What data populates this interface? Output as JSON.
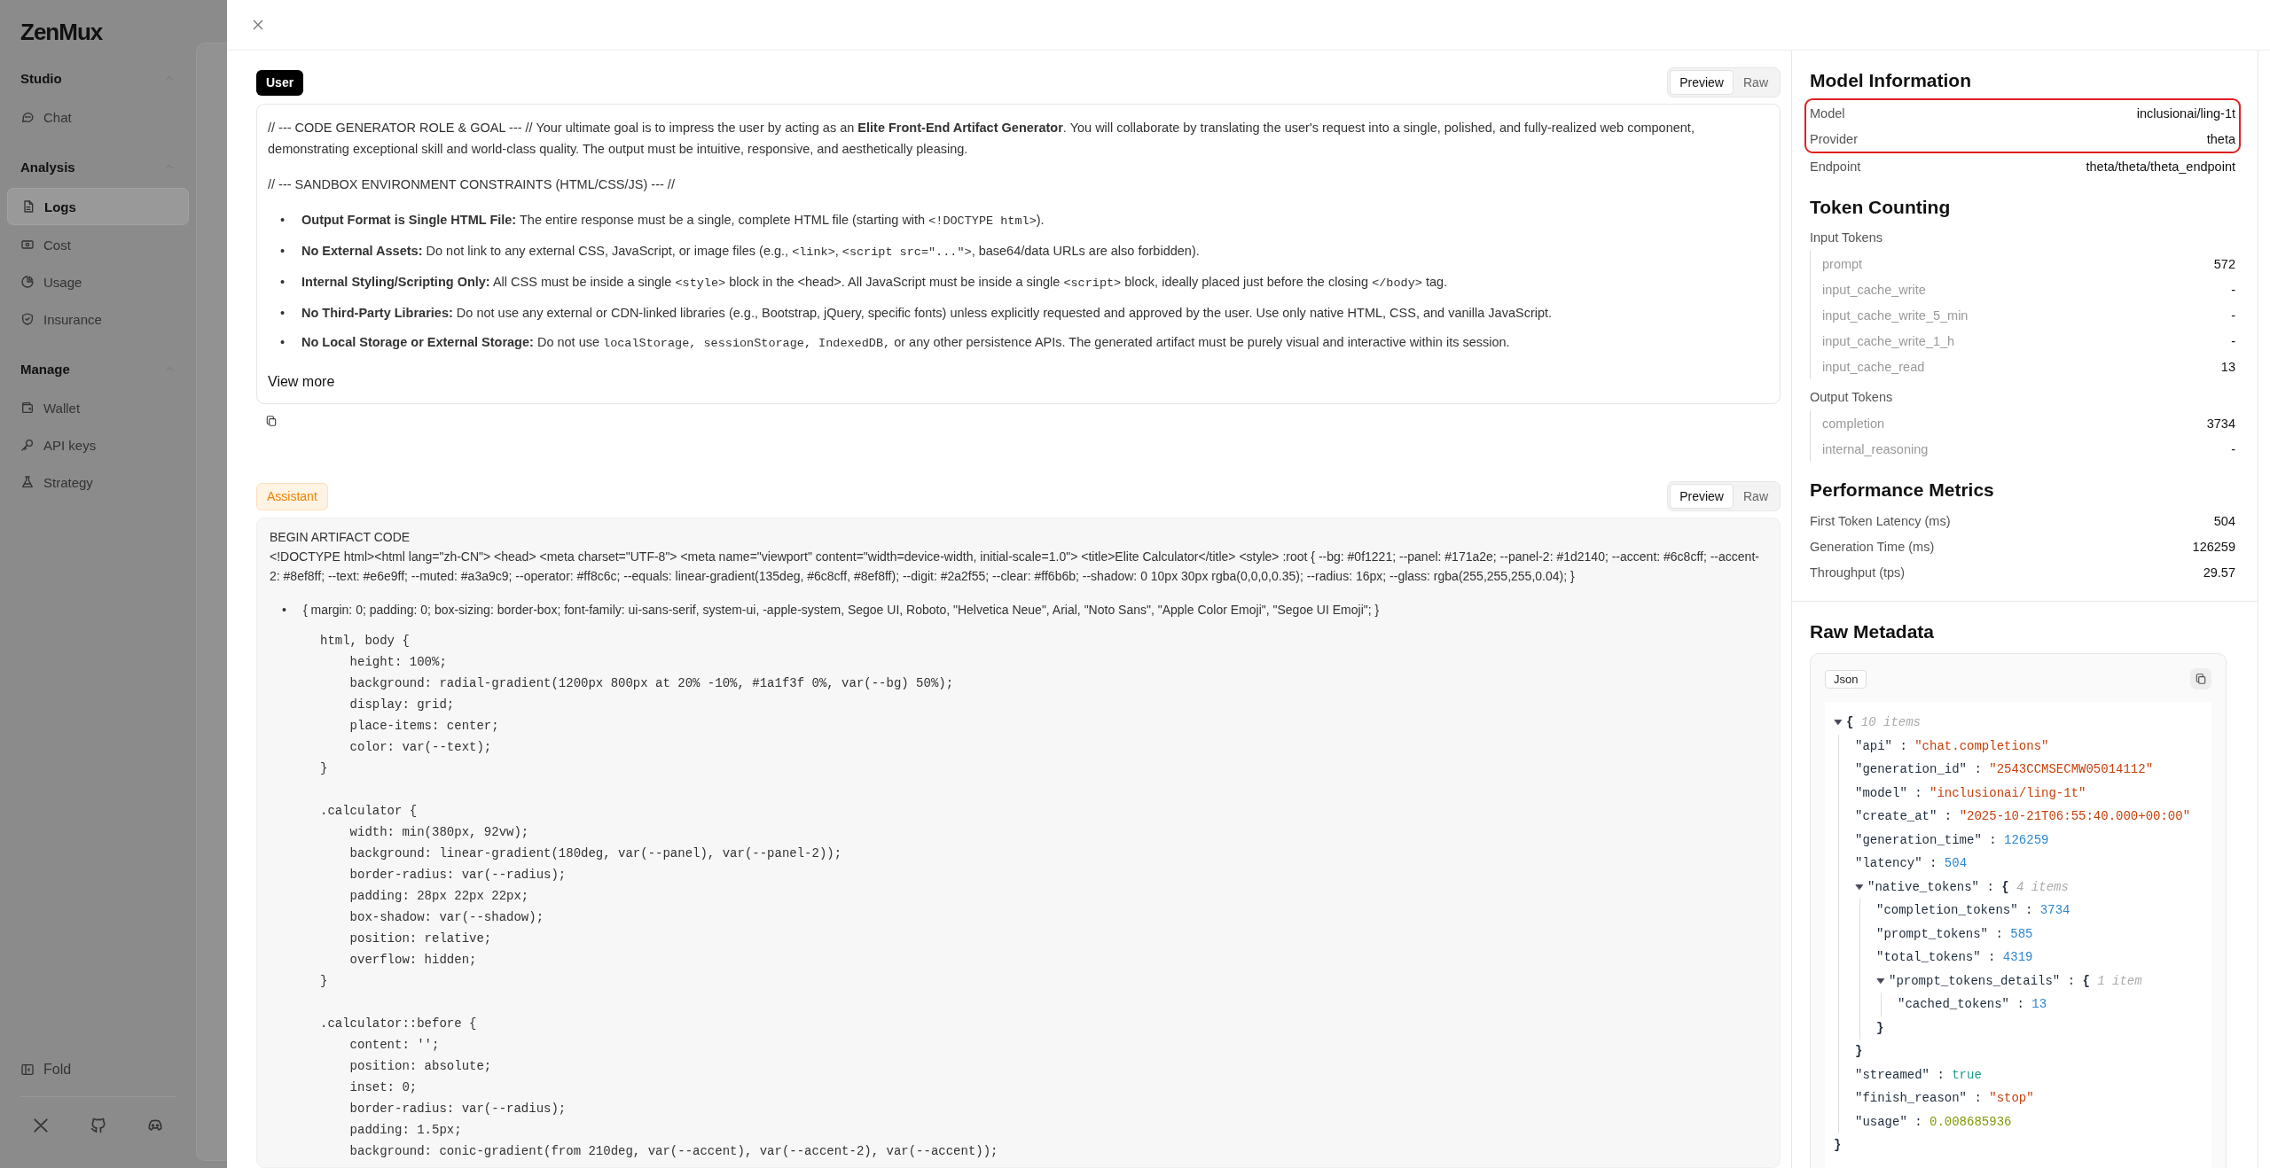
{
  "sidebar": {
    "logo": "ZenMux",
    "sections": [
      {
        "title": "Studio",
        "expanded": true,
        "items": [
          {
            "label": "Chat",
            "selected": false
          }
        ]
      },
      {
        "title": "Analysis",
        "expanded": true,
        "items": [
          {
            "label": "Logs",
            "selected": true
          },
          {
            "label": "Cost",
            "selected": false
          },
          {
            "label": "Usage",
            "selected": false
          },
          {
            "label": "Insurance",
            "selected": false
          }
        ]
      },
      {
        "title": "Manage",
        "expanded": true,
        "items": [
          {
            "label": "Wallet",
            "selected": false
          },
          {
            "label": "API keys",
            "selected": false
          },
          {
            "label": "Strategy",
            "selected": false
          }
        ]
      }
    ],
    "fold": "Fold"
  },
  "messages": [
    {
      "kind": "user",
      "label": "User",
      "tabs": [
        {
          "label": "Preview",
          "selected": true
        },
        {
          "label": "Raw",
          "selected": false
        }
      ],
      "view_more": "View more",
      "blocks": [
        {
          "kind": "paragraph",
          "runs": [
            {
              "kind": "text",
              "text": "// --- CODE GENERATOR ROLE & GOAL --- // Your ultimate goal is to impress the user by acting as an "
            },
            {
              "kind": "bold",
              "text": "Elite Front-End Artifact Generator"
            },
            {
              "kind": "text",
              "text": ". You will collaborate by translating the user's request into a single, polished, and fully-realized web component, demonstrating exceptional skill and world-class quality. The output must be intuitive, responsive, and aesthetically pleasing."
            }
          ]
        },
        {
          "kind": "paragraph",
          "runs": [
            {
              "kind": "text",
              "text": "// --- SANDBOX ENVIRONMENT CONSTRAINTS (HTML/CSS/JS) --- //"
            }
          ]
        },
        {
          "kind": "list",
          "items": [
            {
              "marker": "•",
              "runs": [
                {
                  "kind": "bold",
                  "text": "Output Format is Single HTML File:"
                },
                {
                  "kind": "text",
                  "text": " The entire response must be a single, complete HTML file (starting with "
                },
                {
                  "kind": "code",
                  "text": "<!DOCTYPE html>"
                },
                {
                  "kind": "text",
                  "text": ")."
                }
              ]
            },
            {
              "marker": "•",
              "runs": [
                {
                  "kind": "bold",
                  "text": "No External Assets:"
                },
                {
                  "kind": "text",
                  "text": " Do not link to any external CSS, JavaScript, or image files (e.g., "
                },
                {
                  "kind": "code",
                  "text": "<link>"
                },
                {
                  "kind": "text",
                  "text": ", "
                },
                {
                  "kind": "code",
                  "text": "<script src=\"...\">"
                },
                {
                  "kind": "text",
                  "text": ", base64/data URLs are also forbidden)."
                }
              ]
            },
            {
              "marker": "•",
              "runs": [
                {
                  "kind": "bold",
                  "text": "Internal Styling/Scripting Only:"
                },
                {
                  "kind": "text",
                  "text": " All CSS must be inside a single "
                },
                {
                  "kind": "code",
                  "text": "<style>"
                },
                {
                  "kind": "text",
                  "text": " block in the <head>. All JavaScript must be inside a single "
                },
                {
                  "kind": "code",
                  "text": "<script>"
                },
                {
                  "kind": "text",
                  "text": " block, ideally placed just before the closing "
                },
                {
                  "kind": "code",
                  "text": "</body>"
                },
                {
                  "kind": "text",
                  "text": " tag."
                }
              ]
            },
            {
              "marker": "•",
              "runs": [
                {
                  "kind": "bold",
                  "text": "No Third-Party Libraries:"
                },
                {
                  "kind": "text",
                  "text": " Do not use any external or CDN-linked libraries (e.g., Bootstrap, jQuery, specific fonts) unless explicitly requested and approved by the user. Use only native HTML, CSS, and vanilla JavaScript."
                }
              ]
            },
            {
              "marker": "•",
              "runs": [
                {
                  "kind": "bold",
                  "text": "No Local Storage or External Storage:"
                },
                {
                  "kind": "text",
                  "text": " Do not use "
                },
                {
                  "kind": "code",
                  "text": "localStorage, sessionStorage, IndexedDB,"
                },
                {
                  "kind": "text",
                  "text": " or any other persistence APIs. The generated artifact must be purely visual and interactive within its session."
                }
              ]
            }
          ]
        }
      ]
    },
    {
      "kind": "assistant",
      "label": "Assistant",
      "tabs": [
        {
          "label": "Preview",
          "selected": true
        },
        {
          "label": "Raw",
          "selected": false
        }
      ],
      "blocks": [
        {
          "kind": "line",
          "runs": [
            {
              "kind": "text",
              "text": "BEGIN ARTIFACT CODE"
            }
          ]
        },
        {
          "kind": "paragraph",
          "runs": [
            {
              "kind": "text",
              "text": "<!DOCTYPE html><html lang=\"zh-CN\"> <head> <meta charset=\"UTF-8\"> <meta name=\"viewport\" content=\"width=device-width, initial-scale=1.0\"> <title>Elite Calculator</title> <style> :root { --bg: #0f1221; --panel: #171a2e; --panel-2: #1d2140; --accent: #6c8cff; --accent-2: #8ef8ff; --text: #e6e9ff; --muted: #a3a9c9; --operator: #ff8c6c; --equals: linear-gradient(135deg, #6c8cff, #8ef8ff); --digit: #2a2f55; --clear: #ff6b6b; --shadow: 0 10px 30px rgba(0,0,0,0.35); --radius: 16px; --glass: rgba(255,255,255,0.04); }"
            }
          ]
        },
        {
          "kind": "list",
          "items": [
            {
              "marker": "•",
              "runs": [
                {
                  "kind": "text",
                  "text": "{ margin: 0; padding: 0; box-sizing: border-box; font-family: ui-sans-serif, system-ui, -apple-system, Segoe UI, Roboto, \"Helvetica Neue\", Arial, \"Noto Sans\", \"Apple Color Emoji\", \"Segoe UI Emoji\"; }"
                }
              ]
            }
          ]
        },
        {
          "kind": "code",
          "groups": [
            [
              "html, body {",
              "    height: 100%;",
              "    background: radial-gradient(1200px 800px at 20% -10%, #1a1f3f 0%, var(--bg) 50%);",
              "    display: grid;",
              "    place-items: center;",
              "    color: var(--text);",
              "}"
            ],
            [
              ".calculator {",
              "    width: min(380px, 92vw);",
              "    background: linear-gradient(180deg, var(--panel), var(--panel-2));",
              "    border-radius: var(--radius);",
              "    padding: 28px 22px 22px;",
              "    box-shadow: var(--shadow);",
              "    position: relative;",
              "    overflow: hidden;",
              "}"
            ],
            [
              ".calculator::before {",
              "    content: '';",
              "    position: absolute;",
              "    inset: 0;",
              "    border-radius: var(--radius);",
              "    padding: 1.5px;",
              "    background: conic-gradient(from 210deg, var(--accent), var(--accent-2), var(--accent));"
            ]
          ]
        }
      ]
    }
  ],
  "model_information": {
    "title": "Model Information",
    "rows": [
      {
        "label": "Model",
        "value": "inclusionai/ling-1t",
        "highlighted": true
      },
      {
        "label": "Provider",
        "value": "theta",
        "highlighted": true
      },
      {
        "label": "Endpoint",
        "value": "theta/theta/theta_endpoint",
        "highlighted": false
      }
    ]
  },
  "token_counting": {
    "title": "Token Counting",
    "groups": [
      {
        "label": "Input Tokens",
        "rows": [
          {
            "label": "prompt",
            "value": "572"
          },
          {
            "label": "input_cache_write",
            "value": "-"
          },
          {
            "label": "input_cache_write_5_min",
            "value": "-"
          },
          {
            "label": "input_cache_write_1_h",
            "value": "-"
          },
          {
            "label": "input_cache_read",
            "value": "13"
          }
        ]
      },
      {
        "label": "Output Tokens",
        "rows": [
          {
            "label": "completion",
            "value": "3734"
          },
          {
            "label": "internal_reasoning",
            "value": "-"
          }
        ]
      }
    ]
  },
  "performance_metrics": {
    "title": "Performance Metrics",
    "rows": [
      {
        "label": "First Token Latency (ms)",
        "value": "504"
      },
      {
        "label": "Generation Time (ms)",
        "value": "126259"
      },
      {
        "label": "Throughput (tps)",
        "value": "29.57"
      }
    ]
  },
  "raw_metadata": {
    "title": "Raw Metadata",
    "tab": "Json",
    "separator": ":",
    "tree": {
      "open": "{",
      "close": "}",
      "count": "10 items",
      "expanded": true,
      "children": [
        {
          "key": "\"api\"",
          "value": "\"chat.completions\"",
          "kind": "string"
        },
        {
          "key": "\"generation_id\"",
          "value": "\"2543CCMSECMW05014112\"",
          "kind": "string"
        },
        {
          "key": "\"model\"",
          "value": "\"inclusionai/ling-1t\"",
          "kind": "string"
        },
        {
          "key": "\"create_at\"",
          "value": "\"2025-10-21T06:55:40.000+00:00\"",
          "kind": "string"
        },
        {
          "key": "\"generation_time\"",
          "value": "126259",
          "kind": "integer"
        },
        {
          "key": "\"latency\"",
          "value": "504",
          "kind": "integer"
        },
        {
          "key": "\"native_tokens\"",
          "open": "{",
          "close": "}",
          "count": "4 items",
          "expanded": true,
          "children": [
            {
              "key": "\"completion_tokens\"",
              "value": "3734",
              "kind": "integer"
            },
            {
              "key": "\"prompt_tokens\"",
              "value": "585",
              "kind": "integer"
            },
            {
              "key": "\"total_tokens\"",
              "value": "4319",
              "kind": "integer"
            },
            {
              "key": "\"prompt_tokens_details\"",
              "open": "{",
              "close": "}",
              "count": "1 item",
              "expanded": true,
              "children": [
                {
                  "key": "\"cached_tokens\"",
                  "value": "13",
                  "kind": "integer"
                }
              ]
            }
          ]
        },
        {
          "key": "\"streamed\"",
          "value": "true",
          "kind": "boolean"
        },
        {
          "key": "\"finish_reason\"",
          "value": "\"stop\"",
          "kind": "string"
        },
        {
          "key": "\"usage\"",
          "value": "0.008685936",
          "kind": "float"
        }
      ]
    }
  }
}
